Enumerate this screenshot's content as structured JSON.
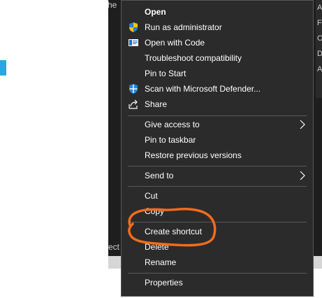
{
  "background": {
    "left_text": "he",
    "bottom_text": "ect",
    "right_letters": [
      "A",
      "F",
      "C",
      "D",
      "A"
    ]
  },
  "menu": {
    "items": [
      {
        "label": "Open",
        "bold": true
      },
      {
        "label": "Run as administrator",
        "icon": "shield-icon"
      },
      {
        "label": "Open with Code",
        "icon": "vscode-icon"
      },
      {
        "label": "Troubleshoot compatibility"
      },
      {
        "label": "Pin to Start"
      },
      {
        "label": "Scan with Microsoft Defender...",
        "icon": "defender-icon"
      },
      {
        "label": "Share",
        "icon": "share-icon"
      },
      {
        "label": "Give access to",
        "submenu": true
      },
      {
        "label": "Pin to taskbar"
      },
      {
        "label": "Restore previous versions"
      },
      {
        "label": "Send to",
        "submenu": true
      },
      {
        "label": "Cut"
      },
      {
        "label": "Copy"
      },
      {
        "label": "Create shortcut"
      },
      {
        "label": "Delete"
      },
      {
        "label": "Rename"
      },
      {
        "label": "Properties"
      }
    ]
  },
  "colors": {
    "menu_bg": "#2b2b2b",
    "menu_text": "#ffffff",
    "annotation": "#f26b1d",
    "accent": "#29a8e0"
  }
}
